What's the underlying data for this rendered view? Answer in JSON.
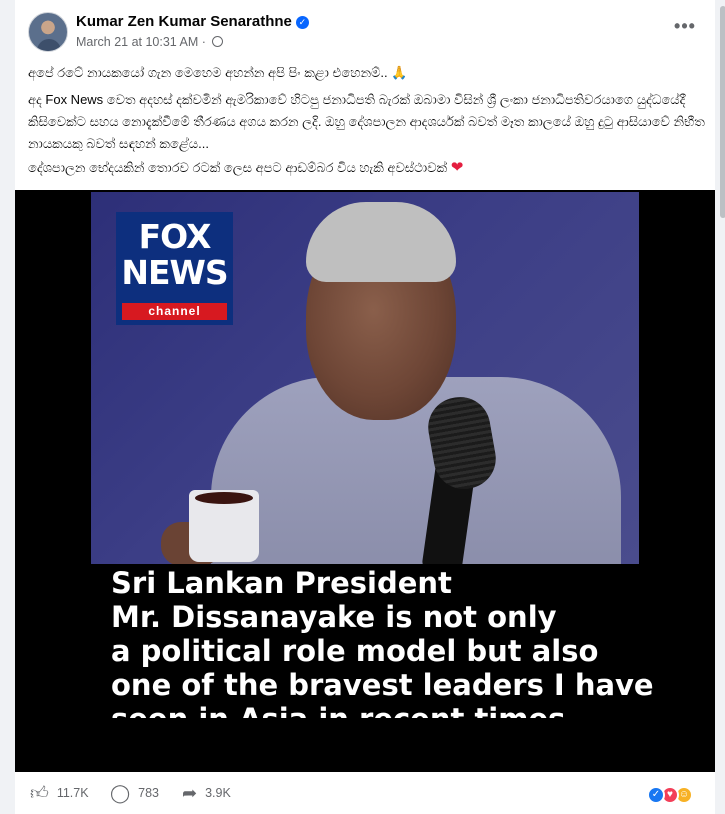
{
  "post": {
    "author": "Kumar Zen Kumar Senarathne",
    "timestamp": "March 21 at 10:31 AM",
    "separator": "·",
    "more_label": "•••",
    "paragraphs": [
      "අපේ රටේ නායකයෝ ගැන මෙහෙම අහන්න අපි පිං කළා එහෙනම්..",
      "අද Fox News වෙත අදහස් දක්වමින් ඇමරිකාවේ හිටපු ජනාධිපති බැරක් ඔබාමා විසින් ශ්‍රී ලංකා ජනාධිපතිවරයාගෙ යුද්ධයේදී කිසිවෙක්ට සහය නොදැක්වීමේ තීරණය අගය කරන ලදි. ඔහු දේශපාලන ආදශර්යක් බවත් මෑත කාලයේ ඔහු දුටු ආසියාවේ නිභීත නායකයකු බවත් සඳහන් කළේය...",
      "දේශපාලන භේදයකින් තොරව රටක් ලෙස අපට ආඩම්බර විය හැකි අවස්ථාවක්"
    ],
    "emoji_pray": "🙏",
    "emoji_heart": "❤"
  },
  "media": {
    "logo_line1": "FOX",
    "logo_line2": "NEWS",
    "logo_line3": "channel",
    "caption_lines": [
      "Sri Lankan President",
      "Mr. Dissanayake is not only",
      "a political role model but also",
      "one of the bravest leaders I have",
      "seen in Asia in recent times."
    ]
  },
  "footer": {
    "likes": "11.7K",
    "comments": "783",
    "shares": "3.9K"
  },
  "icons": {
    "verified": "verified-badge-icon",
    "privacy": "globe-icon",
    "like": "thumbs-up-icon",
    "comment": "comment-bubble-icon",
    "share": "share-arrow-icon",
    "reactions": [
      "like-reaction-icon",
      "love-reaction-icon",
      "haha-reaction-icon"
    ]
  },
  "colors": {
    "brand_blue": "#0866ff",
    "fox_blue": "#0d2f7e",
    "fox_red": "#d71920",
    "secondary_text": "#65676b"
  }
}
